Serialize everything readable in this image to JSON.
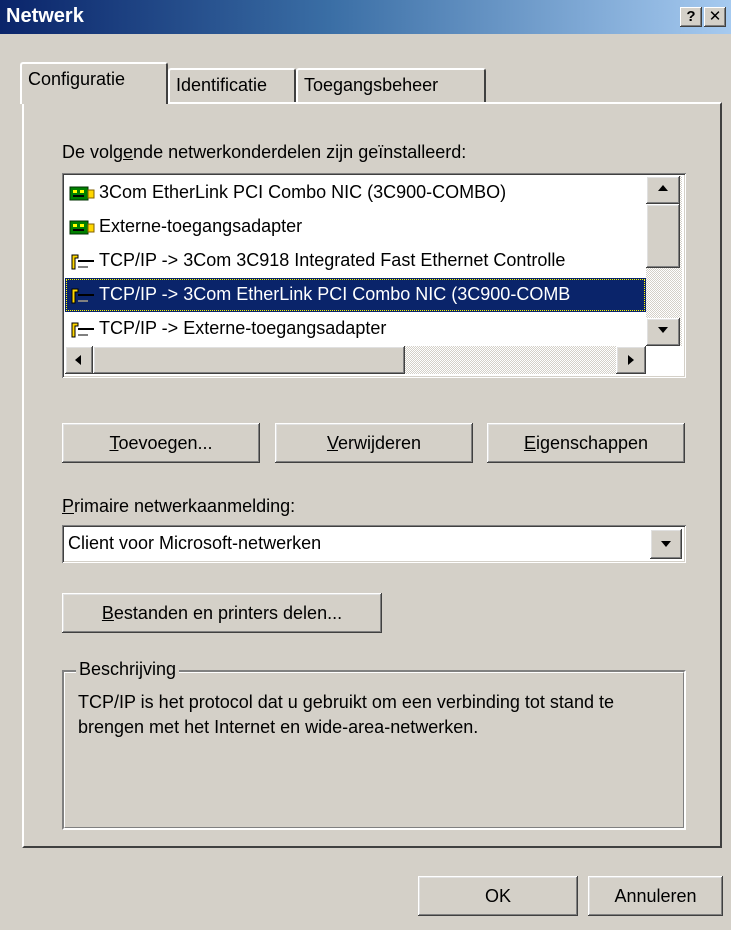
{
  "window": {
    "title": "Netwerk",
    "help_label": "?",
    "close_label": "✕"
  },
  "tabs": [
    "Configuratie",
    "Identificatie",
    "Toegangsbeheer"
  ],
  "installed_label": {
    "pre": "De volg",
    "key": "e",
    "post": "nde netwerkonderdelen zijn geïnstalleerd:"
  },
  "components": [
    {
      "icon": "network-adapter-icon",
      "label": "3Com EtherLink PCI Combo  NIC (3C900-COMBO)"
    },
    {
      "icon": "network-adapter-icon",
      "label": "Externe-toegangsadapter"
    },
    {
      "icon": "protocol-icon",
      "label": "TCP/IP -> 3Com 3C918 Integrated Fast Ethernet Controlle"
    },
    {
      "icon": "protocol-icon",
      "label": "TCP/IP -> 3Com EtherLink PCI Combo  NIC (3C900-COMB"
    },
    {
      "icon": "protocol-icon",
      "label": "TCP/IP -> Externe-toegangsadapter"
    }
  ],
  "selected_index": 3,
  "buttons": {
    "add": {
      "key": "T",
      "rest": "oevoegen..."
    },
    "remove": {
      "key": "V",
      "rest": "erwijderen"
    },
    "properties": {
      "key": "E",
      "rest": "igenschappen"
    },
    "share": {
      "key": "B",
      "rest": "estanden en printers delen..."
    }
  },
  "primary_logon": {
    "key": "P",
    "rest": "rimaire netwerkaanmelding:",
    "value": "Client voor Microsoft-netwerken"
  },
  "description": {
    "legend": "Beschrijving",
    "text": "TCP/IP is het protocol dat u gebruikt om een verbinding tot stand te brengen met het Internet en wide-area-netwerken."
  },
  "footer": {
    "ok": "OK",
    "cancel": "Annuleren"
  },
  "colors": {
    "selection": "#0a246a",
    "face": "#d4d0c8"
  }
}
